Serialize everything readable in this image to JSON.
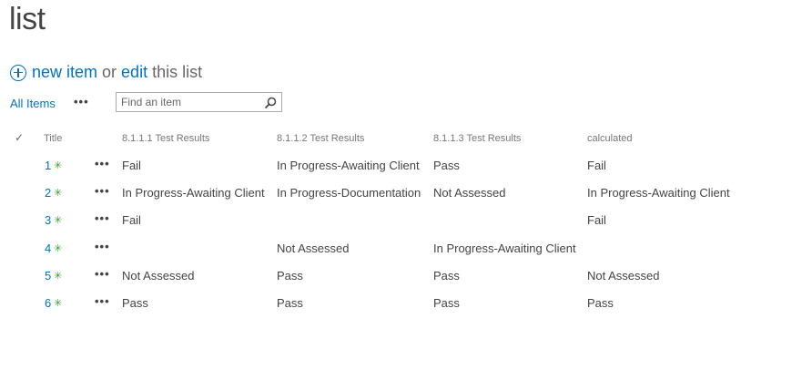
{
  "page": {
    "title": "list"
  },
  "actions": {
    "new_item": "new item",
    "or": "or",
    "edit": "edit",
    "this_list": "this list"
  },
  "view": {
    "label": "All Items",
    "more": "•••"
  },
  "search": {
    "placeholder": "Find an item",
    "value": ""
  },
  "columns": [
    "Title",
    "8.1.1.1 Test Results",
    "8.1.1.2 Test Results",
    "8.1.1.3 Test Results",
    "calculated"
  ],
  "row_menu": "•••",
  "rows": [
    {
      "title": "1",
      "c1": "Fail",
      "c2": "In Progress-Awaiting Client",
      "c3": "Pass",
      "calc": "Fail"
    },
    {
      "title": "2",
      "c1": "In Progress-Awaiting Client",
      "c2": "In Progress-Documentation",
      "c3": "Not Assessed",
      "calc": "In Progress-Awaiting Client"
    },
    {
      "title": "3",
      "c1": "Fail",
      "c2": "",
      "c3": "",
      "calc": "Fail"
    },
    {
      "title": "4",
      "c1": "",
      "c2": "Not Assessed",
      "c3": "In Progress-Awaiting Client",
      "calc": ""
    },
    {
      "title": "5",
      "c1": "Not Assessed",
      "c2": "Pass",
      "c3": "Pass",
      "calc": "Not Assessed"
    },
    {
      "title": "6",
      "c1": "Pass",
      "c2": "Pass",
      "c3": "Pass",
      "calc": "Pass"
    }
  ],
  "colors": {
    "link": "#0072c6",
    "new_badge": "#3a9b2f"
  }
}
